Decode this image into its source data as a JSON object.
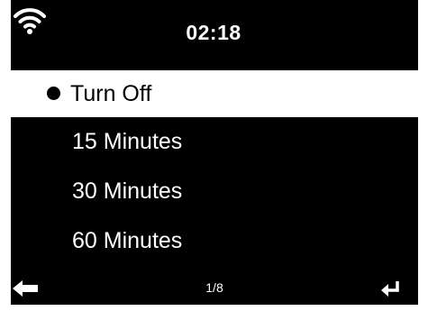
{
  "status_bar": {
    "wifi_icon": "wifi-icon",
    "time": "02:18"
  },
  "menu": {
    "items": [
      {
        "label": "Turn Off",
        "selected": true
      },
      {
        "label": "15 Minutes",
        "selected": false
      },
      {
        "label": "30 Minutes",
        "selected": false
      },
      {
        "label": "60 Minutes",
        "selected": false
      }
    ]
  },
  "footer": {
    "back_icon": "back-arrow-icon",
    "page_indicator": "1/8",
    "enter_icon": "enter-icon"
  },
  "colors": {
    "background": "#000000",
    "foreground": "#ffffff",
    "selection_background": "#ffffff",
    "selection_text": "#000000"
  }
}
